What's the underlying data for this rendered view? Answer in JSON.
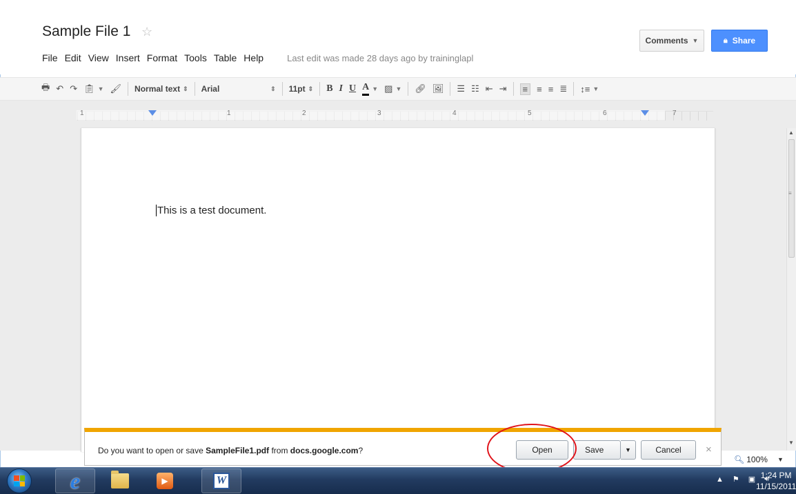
{
  "header": {
    "doc_title": "Sample File 1",
    "menu": [
      "File",
      "Edit",
      "View",
      "Insert",
      "Format",
      "Tools",
      "Table",
      "Help"
    ],
    "last_edit": "Last edit was made 28 days ago by traininglapl",
    "comments_label": "Comments",
    "share_label": "Share"
  },
  "toolbar": {
    "style_value": "Normal text",
    "font_value": "Arial",
    "size_value": "11pt",
    "bold": "B",
    "italic": "I",
    "underline": "U",
    "text_color": "A"
  },
  "ruler": {
    "numbers": [
      "1",
      "1",
      "2",
      "3",
      "4",
      "5",
      "6",
      "7"
    ]
  },
  "document": {
    "text": "This is a test document."
  },
  "download_bar": {
    "msg_prefix": "Do you want to open or save ",
    "file_name": "SampleFile1.pdf",
    "msg_middle": " from ",
    "domain": "docs.google.com",
    "msg_suffix": "?",
    "open_label": "Open",
    "save_label": "Save",
    "cancel_label": "Cancel",
    "close_glyph": "×"
  },
  "zoom": {
    "value": "100%"
  },
  "taskbar": {
    "clock_time": "1:24 PM",
    "clock_date": "11/15/2011"
  },
  "colors": {
    "share_blue": "#4d90fe",
    "notify_accent": "#f0a500",
    "highlight_red": "#e0131a"
  }
}
